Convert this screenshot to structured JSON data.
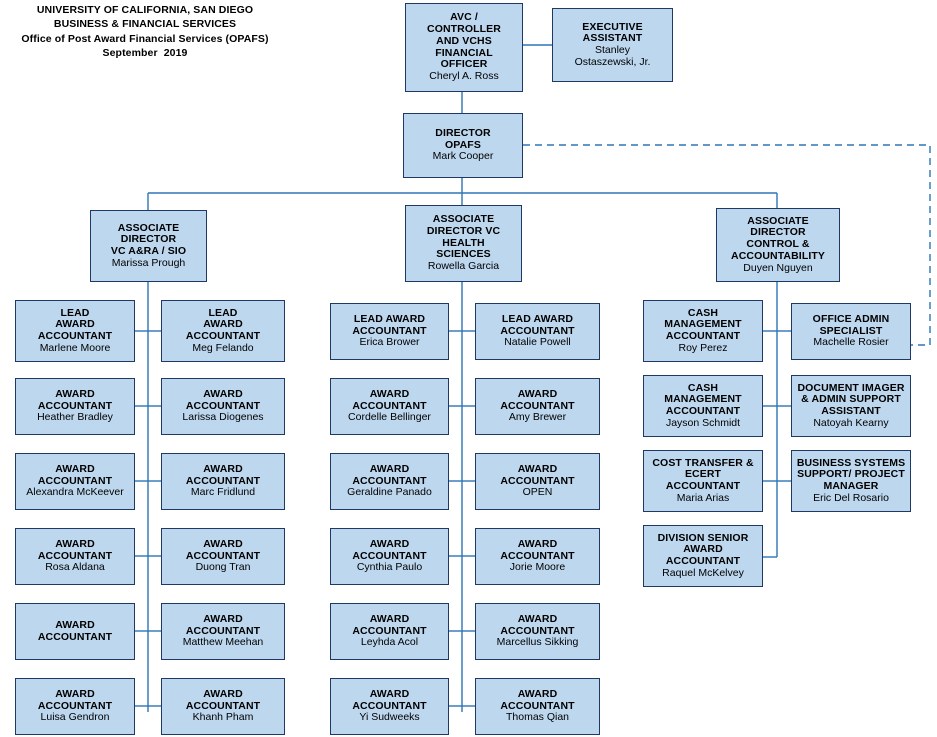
{
  "header": {
    "line1": "UNIVERSITY OF CALIFORNIA, SAN DIEGO",
    "line2": "BUSINESS & FINANCIAL SERVICES",
    "line3": "Office of Post Award Financial Services (OPAFS)",
    "line4": "September  2019"
  },
  "colors": {
    "box_fill": "#bdd7ee",
    "box_border": "#1f3864",
    "connector": "#2e75b6",
    "text": "#000000"
  },
  "chart_data": {
    "type": "org-chart",
    "title": "Office of Post Award Financial Services (OPAFS) Organization Chart",
    "nodes": [
      {
        "id": "avc",
        "title": "AVC /\nCONTROLLER\nAND VCHS\nFINANCIAL\nOFFICER",
        "name": "Cheryl A. Ross"
      },
      {
        "id": "exec_asst",
        "title": "EXECUTIVE\nASSISTANT",
        "name": "Stanley\nOstaszewski, Jr."
      },
      {
        "id": "director",
        "title": "DIRECTOR\nOPAFS",
        "name": "Mark Cooper"
      },
      {
        "id": "assoc_vcara",
        "title": "ASSOCIATE\nDIRECTOR\nVC A&RA / SIO",
        "name": "Marissa Prough"
      },
      {
        "id": "assoc_vchs",
        "title": "ASSOCIATE\nDIRECTOR VC\nHEALTH\nSCIENCES",
        "name": "Rowella Garcia"
      },
      {
        "id": "assoc_ctrl",
        "title": "ASSOCIATE\nDIRECTOR\nCONTROL &\nACCOUNTABILITY",
        "name": "Duyen Nguyen"
      },
      {
        "id": "c1r1",
        "title": "LEAD\nAWARD\nACCOUNTANT",
        "name": "Marlene Moore"
      },
      {
        "id": "c1r2",
        "title": "AWARD\nACCOUNTANT",
        "name": "Heather Bradley"
      },
      {
        "id": "c1r3",
        "title": "AWARD\nACCOUNTANT",
        "name": "Alexandra McKeever"
      },
      {
        "id": "c1r4",
        "title": "AWARD\nACCOUNTANT",
        "name": "Rosa Aldana"
      },
      {
        "id": "c1r5",
        "title": "AWARD\nACCOUNTANT",
        "name": ""
      },
      {
        "id": "c1r6",
        "title": "AWARD\nACCOUNTANT",
        "name": "Luisa Gendron"
      },
      {
        "id": "c2r1",
        "title": "LEAD\nAWARD\nACCOUNTANT",
        "name": "Meg Felando"
      },
      {
        "id": "c2r2",
        "title": "AWARD\nACCOUNTANT",
        "name": "Larissa Diogenes"
      },
      {
        "id": "c2r3",
        "title": "AWARD\nACCOUNTANT",
        "name": "Marc Fridlund"
      },
      {
        "id": "c2r4",
        "title": "AWARD\nACCOUNTANT",
        "name": "Duong Tran"
      },
      {
        "id": "c2r5",
        "title": "AWARD\nACCOUNTANT",
        "name": "Matthew Meehan"
      },
      {
        "id": "c2r6",
        "title": "AWARD\nACCOUNTANT",
        "name": "Khanh Pham"
      },
      {
        "id": "c3r1",
        "title": "LEAD AWARD\nACCOUNTANT",
        "name": "Erica Brower"
      },
      {
        "id": "c3r2",
        "title": "AWARD\nACCOUNTANT",
        "name": "Cordelle Bellinger"
      },
      {
        "id": "c3r3",
        "title": "AWARD\nACCOUNTANT",
        "name": "Geraldine Panado"
      },
      {
        "id": "c3r4",
        "title": "AWARD\nACCOUNTANT",
        "name": "Cynthia Paulo"
      },
      {
        "id": "c3r5",
        "title": "AWARD\nACCOUNTANT",
        "name": "Leyhda Acol"
      },
      {
        "id": "c3r6",
        "title": "AWARD\nACCOUNTANT",
        "name": "Yi Sudweeks"
      },
      {
        "id": "c4r1",
        "title": "LEAD AWARD\nACCOUNTANT",
        "name": "Natalie Powell"
      },
      {
        "id": "c4r2",
        "title": "AWARD\nACCOUNTANT",
        "name": "Amy Brewer"
      },
      {
        "id": "c4r3",
        "title": "AWARD\nACCOUNTANT",
        "name": "OPEN"
      },
      {
        "id": "c4r4",
        "title": "AWARD\nACCOUNTANT",
        "name": "Jorie Moore"
      },
      {
        "id": "c4r5",
        "title": "AWARD\nACCOUNTANT",
        "name": "Marcellus Sikking"
      },
      {
        "id": "c4r6",
        "title": "AWARD\nACCOUNTANT",
        "name": "Thomas Qian"
      },
      {
        "id": "c5r1",
        "title": "CASH\nMANAGEMENT\nACCOUNTANT",
        "name": "Roy Perez"
      },
      {
        "id": "c5r2",
        "title": "CASH\nMANAGEMENT\nACCOUNTANT",
        "name": "Jayson Schmidt"
      },
      {
        "id": "c5r3",
        "title": "COST TRANSFER &\nECERT\nACCOUNTANT",
        "name": "Maria Arias"
      },
      {
        "id": "c5r4",
        "title": "DIVISION SENIOR\nAWARD\nACCOUNTANT",
        "name": "Raquel McKelvey"
      },
      {
        "id": "c6r1",
        "title": "OFFICE ADMIN\nSPECIALIST",
        "name": "Machelle Rosier"
      },
      {
        "id": "c6r2",
        "title": "DOCUMENT IMAGER\n& ADMIN SUPPORT\nASSISTANT",
        "name": "Natoyah Kearny"
      },
      {
        "id": "c6r3",
        "title": "BUSINESS SYSTEMS\nSUPPORT/ PROJECT\nMANAGER",
        "name": "Eric Del Rosario"
      }
    ],
    "edges": [
      {
        "from": "avc",
        "to": "exec_asst",
        "style": "solid"
      },
      {
        "from": "avc",
        "to": "director",
        "style": "solid"
      },
      {
        "from": "director",
        "to": "assoc_vcara",
        "style": "solid"
      },
      {
        "from": "director",
        "to": "assoc_vchs",
        "style": "solid"
      },
      {
        "from": "director",
        "to": "assoc_ctrl",
        "style": "solid"
      },
      {
        "from": "director",
        "to": "c6r1",
        "style": "dashed"
      },
      {
        "from": "assoc_vcara",
        "to": "c1r1",
        "style": "solid"
      },
      {
        "from": "assoc_vcara",
        "to": "c2r1",
        "style": "solid"
      },
      {
        "from": "assoc_vchs",
        "to": "c3r1",
        "style": "solid"
      },
      {
        "from": "assoc_vchs",
        "to": "c4r1",
        "style": "solid"
      },
      {
        "from": "assoc_ctrl",
        "to": "c5r1",
        "style": "solid"
      },
      {
        "from": "assoc_ctrl",
        "to": "c6r1",
        "style": "solid"
      }
    ]
  }
}
